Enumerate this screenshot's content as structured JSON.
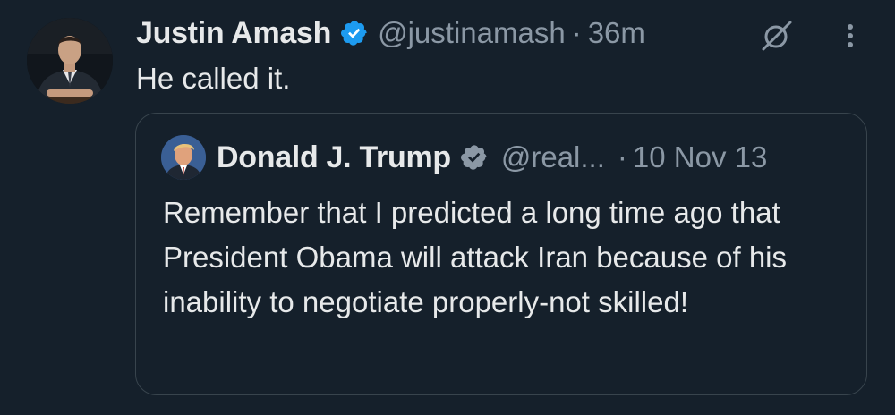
{
  "tweet": {
    "author": {
      "name": "Justin Amash",
      "handle": "@justinamash",
      "avatar_icon": "person-in-suit-avatar"
    },
    "separator": "·",
    "time": "36m",
    "text": "He called it.",
    "actions": {
      "grok_icon": "grok-icon",
      "more_icon": "more-options-icon"
    }
  },
  "quoted_tweet": {
    "author": {
      "name": "Donald J. Trump",
      "handle": "@real...",
      "avatar_icon": "portrait-avatar"
    },
    "separator": "·",
    "date": "10 Nov 13",
    "text": "Remember that I predicted a long time ago that President Obama will attack Iran because of his inability to negotiate properly-not skilled!"
  },
  "colors": {
    "background": "#15202b",
    "primary_text": "#e7e9ea",
    "secondary_text": "#8b98a5",
    "verified_blue": "#1d9bf0",
    "verified_gray": "#8b98a5",
    "border": "#38444d"
  }
}
